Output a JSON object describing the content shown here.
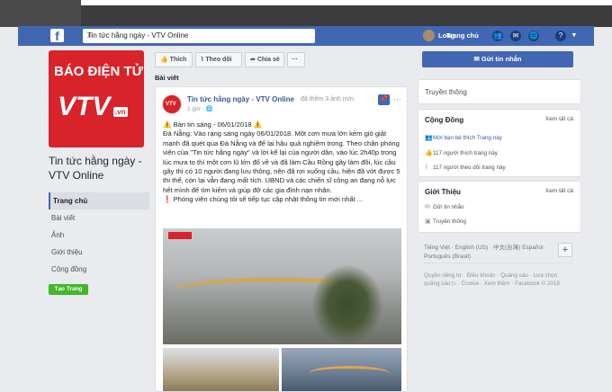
{
  "topnav": {
    "search_value": "Tin tức hằng ngày - VTV Online",
    "user_name": "Long",
    "home_label": "Trang chủ"
  },
  "page": {
    "logo_line1": "BÁO ĐIỆN TỬ",
    "logo_brand": "VTV",
    "logo_suffix": ".vn",
    "name": "Tin tức hằng ngày - VTV Online",
    "nav": [
      "Trang chủ",
      "Bài viết",
      "Ảnh",
      "Giới thiệu",
      "Cộng đồng"
    ],
    "create_button": "Tạo Trang"
  },
  "actions": {
    "like": "Thích",
    "follow": "Theo dõi",
    "share": "Chia sẻ",
    "more": "···"
  },
  "feed": {
    "section_title": "Bài viết",
    "post": {
      "author": "Tin tức hằng ngày - VTV Online",
      "action_text": "đã thêm 3 ảnh mới.",
      "time": "1 giờ · 🌐",
      "lines": [
        "⚠️ Bản tin sáng - 06/01/2018 ⚠️",
        "Đà Nẵng: Vào rạng sáng ngày 06/01/2018. Một cơn mưa lớn kèm gió giật mạnh đã quét qua Đà Nẵng và để lại hậu quả nghiêm trọng. Theo chân phóng viên của \"Tin tức hằng ngày\" và lời kể lại của người dân, vào lúc 2h40p trong lúc mưa to thì một cơn lũ lớn đổ về và đã làm Cầu Rồng gãy làm đôi, lúc cầu gãy thì có 10 người đang lưu thông, nên đã rơi xuống cầu, hiện đã vớt được 5 thi thể, còn lại vẫn đang mất tích. UBND và các chiến sĩ công an đang nỗ lực hết mình để tìm kiếm và giúp đỡ các gia đình nạn nhân.",
        "❗ Phóng viên chúng tôi sẽ tiếp tục cập nhật thông tin mới nhất ..."
      ]
    }
  },
  "right": {
    "send_message": "Gửi tin nhắn",
    "media_label": "Truyền thông",
    "community": {
      "title": "Cộng Đồng",
      "see_all": "Xem tất cả",
      "rows": [
        "Mời bạn bè thích Trang này",
        "117 người thích trang này",
        "117 người theo dõi trang này"
      ]
    },
    "about": {
      "title": "Giới Thiệu",
      "see_all": "Xem tất cả",
      "rows": [
        "Gửi tin nhắn",
        "Truyền thông"
      ]
    },
    "languages": "Tiếng Việt · English (US) · 中文(台灣) Español · Português (Brasil)",
    "footer": "Quyền riêng tư · Điều khoản · Quảng cáo · Lựa chọn quảng cáo ▷ · Cookie · Xem thêm · Facebook © 2018"
  }
}
